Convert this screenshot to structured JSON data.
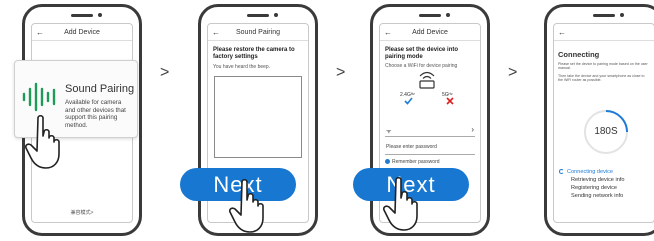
{
  "phone1": {
    "header_title": "Add Device",
    "popup_title": "Sound Pairing",
    "popup_desc": "Available for camera and other devices that support this pairing method.",
    "bottom_link": "兼容模式>"
  },
  "phone2": {
    "header_title": "Sound Pairing",
    "instruction": "Please restore the camera to factory settings",
    "hint": "You have heard the beep."
  },
  "phone3": {
    "header_title": "Add Device",
    "instruction": "Please set the device into pairing mode",
    "choose": "Choose a WiFi for device pairing",
    "band_24": "2.4Gᴴᶻ",
    "band_5": "5Gᴴᶻ",
    "password_placeholder": "Please enter password",
    "remember": "Remember password"
  },
  "phone4": {
    "title": "Connecting",
    "note1": "Please set the device to pairing mode based on the user manual.",
    "note2": "Then take the device and your smartphone as close to the WiFi router as possible.",
    "countdown": "180S",
    "steps": [
      "Connecting device",
      "Retrieving device info",
      "Registering device",
      "Sending network info"
    ]
  },
  "buttons": {
    "next_label_1": "Next",
    "next_label_2": "Next"
  },
  "chevron": ">",
  "colors": {
    "accent": "#1777d1",
    "success": "#1e7bd6",
    "error": "#e02020",
    "wave": "#1f9a5a"
  }
}
